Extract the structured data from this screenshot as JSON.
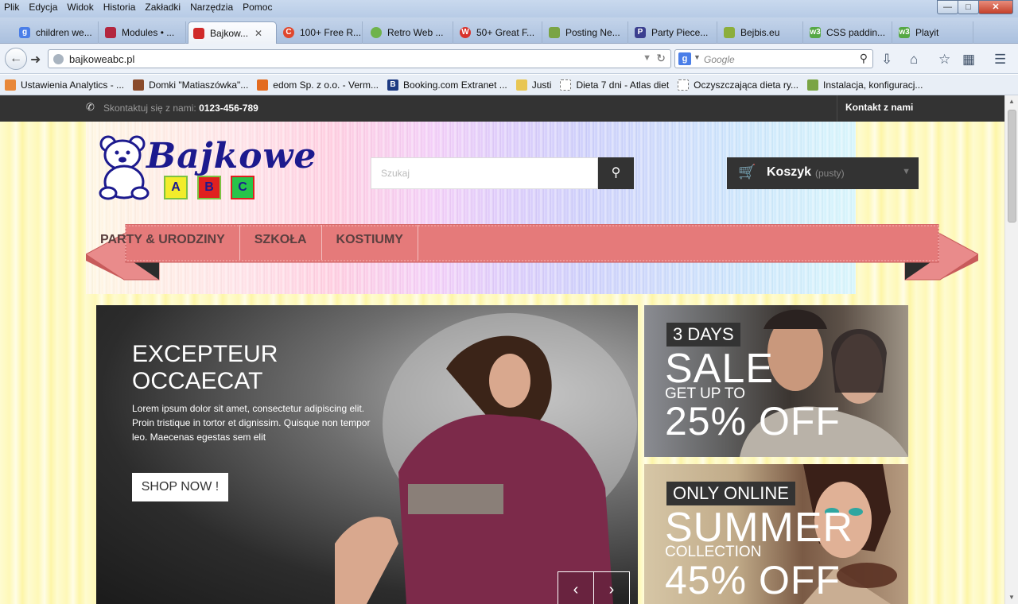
{
  "browser": {
    "menu": [
      "Plik",
      "Edycja",
      "Widok",
      "Historia",
      "Zakładki",
      "Narzędzia",
      "Pomoc"
    ],
    "tabs": [
      {
        "label": "children we...",
        "icon": "google-icon",
        "color": "#4a7ee8"
      },
      {
        "label": "Modules • ...",
        "icon": "modules-icon",
        "color": "#b3263f"
      },
      {
        "label": "Bajkow...",
        "icon": "bajkowe-icon",
        "color": "#d02a2a"
      },
      {
        "label": "100+ Free R...",
        "icon": "c-icon",
        "color": "#e0472d"
      },
      {
        "label": "Retro Web ...",
        "icon": "retro-icon",
        "color": "#6fb34b"
      },
      {
        "label": "50+ Great F...",
        "icon": "w-icon",
        "color": "#d8322c"
      },
      {
        "label": "Posting Ne...",
        "icon": "posting-icon",
        "color": "#7aa444"
      },
      {
        "label": "Party Piece...",
        "icon": "p-icon",
        "color": "#3b3f8f"
      },
      {
        "label": "Bejbis.eu",
        "icon": "bejbis-icon",
        "color": "#8cae3b"
      },
      {
        "label": "CSS paddin...",
        "icon": "w3-icon",
        "color": "#56a844"
      },
      {
        "label": "Playit",
        "icon": "w3-icon",
        "color": "#56a844"
      }
    ],
    "url": "bajkoweabc.pl",
    "search_placeholder": "Google",
    "bookmarks": [
      {
        "label": "Ustawienia Analytics - ...",
        "color": "#e8883a"
      },
      {
        "label": "Domki \"Matiaszówka\"...",
        "color": "#8a4b2b"
      },
      {
        "label": "edom Sp. z o.o. - Verm...",
        "color": "#e36b1f"
      },
      {
        "label": "Booking.com Extranet ...",
        "color": "#1d3a82"
      },
      {
        "label": "Justi",
        "color": "#e8c653"
      },
      {
        "label": "Dieta 7 dni - Atlas diet",
        "color": "#ffffff"
      },
      {
        "label": "Oczyszczająca dieta ry...",
        "color": "#ffffff"
      },
      {
        "label": "Instalacja, konfiguracj...",
        "color": "#7aa444"
      }
    ]
  },
  "page": {
    "topbar": {
      "contact_label": "Skontaktuj się z nami:",
      "phone": "0123-456-789",
      "contact_link": "Kontakt z nami"
    },
    "logo": {
      "line1": "Bajkowe",
      "blocks": [
        "A",
        "B",
        "C"
      ]
    },
    "search_placeholder": "Szukaj",
    "cart": {
      "label": "Koszyk",
      "status": "(pusty)"
    },
    "menu": [
      "PARTY & URODZINY",
      "SZKOŁA",
      "KOSTIUMY"
    ],
    "slider": {
      "heading": "EXCEPTEUR OCCAECAT",
      "body": "Lorem ipsum dolor sit amet, consectetur adipiscing elit. Proin tristique in tortor et dignissim. Quisque non tempor leo. Maecenas egestas sem elit",
      "button": "SHOP NOW !",
      "prev": "‹",
      "next": "›"
    },
    "banner1": {
      "tag": "3 DAYS",
      "big": "SALE",
      "small": "GET UP TO",
      "percent": "25% OFF"
    },
    "banner2": {
      "tag": "ONLY ONLINE",
      "big": "SUMMER",
      "small": "COLLECTION",
      "percent": "45% OFF"
    }
  },
  "colors": {
    "accent_dark": "#333333",
    "ribbon": "#e57a7a",
    "ribbon_dark": "#c85b5b",
    "logo_blue": "#1c1a8e",
    "logo_red": "#e0201f"
  }
}
